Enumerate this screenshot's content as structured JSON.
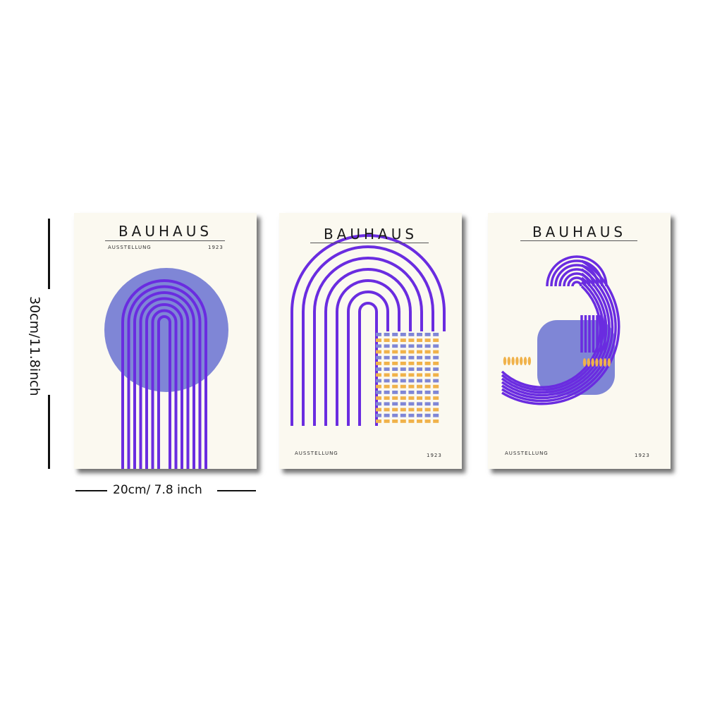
{
  "dimensions": {
    "height_label": "30cm/11.8inch",
    "width_label": "20cm/ 7.8 inch"
  },
  "posters": [
    {
      "title": "BAUHAUS",
      "subtitle": "AUSSTELLUNG",
      "year": "1923"
    },
    {
      "title": "BAUHAUS",
      "subtitle": "AUSSTELLUNG",
      "year": "1923"
    },
    {
      "title": "BAUHAUS",
      "subtitle": "AUSSTELLUNG",
      "year": "1923"
    }
  ],
  "colors": {
    "paper": "#fbf9f0",
    "purple": "#6a2ce0",
    "periwinkle": "#7f86d6",
    "orange": "#f0b24a"
  }
}
